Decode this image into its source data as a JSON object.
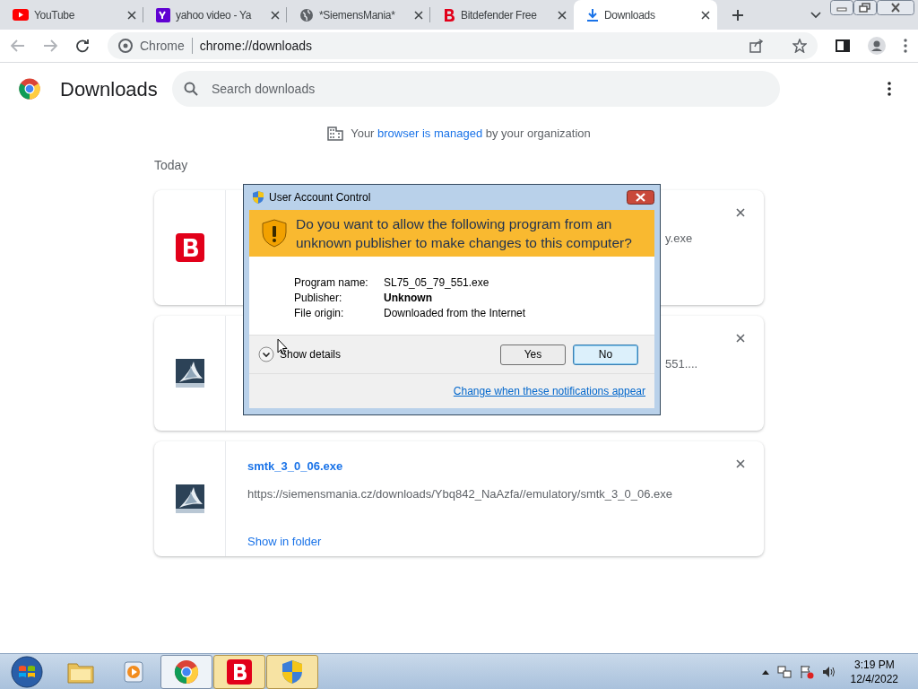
{
  "tabs": [
    {
      "kind": "youtube",
      "title": "YouTube",
      "selected": false
    },
    {
      "kind": "yahoo",
      "title": "yahoo video - Ya",
      "selected": false
    },
    {
      "kind": "globe",
      "title": "*SiemensMania*",
      "selected": false
    },
    {
      "kind": "bitdefender",
      "title": "Bitdefender Free",
      "selected": false
    },
    {
      "kind": "download",
      "title": "Downloads",
      "selected": true
    }
  ],
  "address_bar": {
    "site": "Chrome",
    "url": "chrome://downloads"
  },
  "page": {
    "title": "Downloads",
    "search": {
      "placeholder": "Search downloads"
    },
    "managed_notice": {
      "before": "Your",
      "link": "browser is managed",
      "after": "by your organization"
    },
    "date_heading": "Today",
    "downloads": [
      {
        "kind": "bitdefender",
        "visible_text": "y.exe"
      },
      {
        "kind": "siemens",
        "visible_text": "551...."
      },
      {
        "kind": "siemens",
        "file_name": "smtk_3_0_06.exe",
        "url": "https://siemensmania.cz/downloads/Ybq842_NaAzfa//emulatory/smtk_3_0_06.exe",
        "action": "Show in folder"
      }
    ]
  },
  "uac_dialog": {
    "title": "User Account Control",
    "question": "Do you want to allow the following program from an unknown publisher to make changes to this computer?",
    "fields": [
      {
        "label": "Program name:",
        "value": "SL75_05_79_551.exe",
        "bold": false
      },
      {
        "label": "Publisher:",
        "value": "Unknown",
        "bold": true
      },
      {
        "label": "File origin:",
        "value": "Downloaded from the Internet",
        "bold": false
      }
    ],
    "details_toggle": "Show details",
    "buttons": [
      {
        "label": "Yes",
        "selected": false
      },
      {
        "label": "No",
        "selected": true
      }
    ],
    "link": "Change when these notifications appear"
  },
  "taskbar": {
    "apps": [
      {
        "kind": "folder",
        "active": false
      },
      {
        "kind": "media",
        "active": false
      },
      {
        "kind": "chrome",
        "active": true
      },
      {
        "kind": "bitdefender",
        "active": true
      },
      {
        "kind": "shield",
        "active": true
      }
    ],
    "time": "3:19 PM",
    "date": "12/4/2022"
  }
}
